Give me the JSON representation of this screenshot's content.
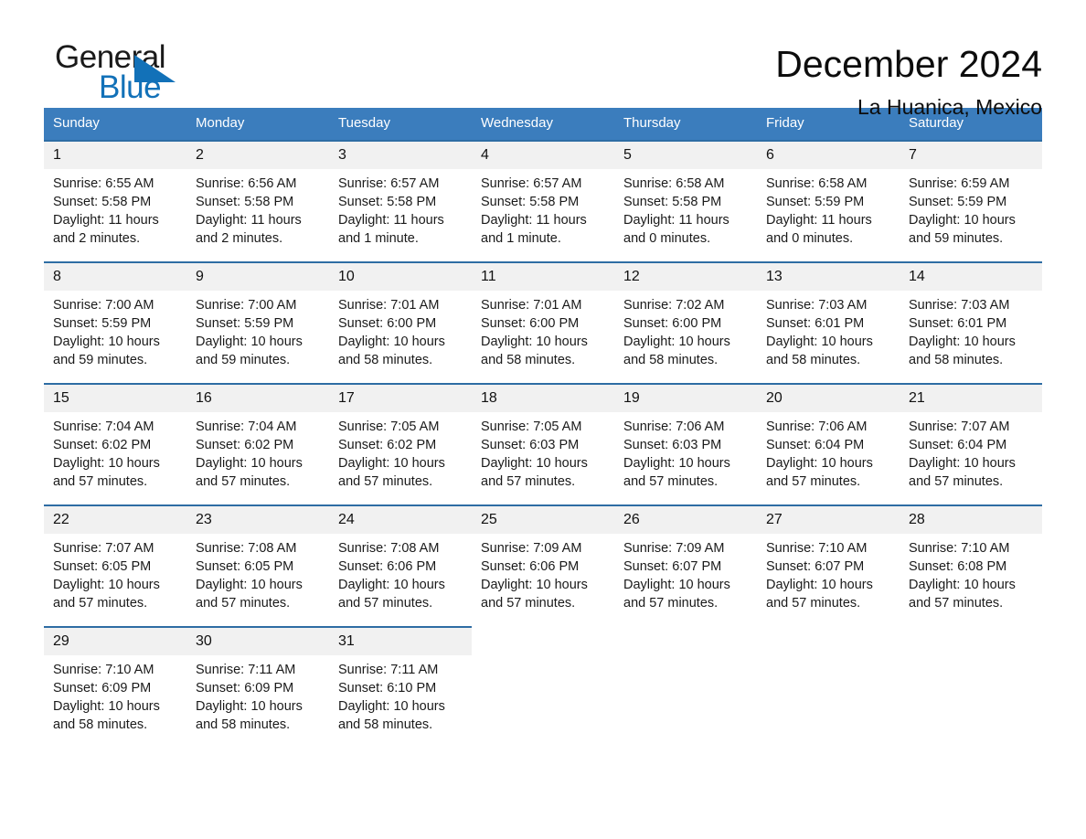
{
  "brand": {
    "name_part1": "General",
    "name_part2": "Blue",
    "accent_color": "#1271b8",
    "triangle_icon": "triangle-icon"
  },
  "header": {
    "title": "December 2024",
    "subtitle": "La Huanica, Mexico"
  },
  "calendar": {
    "header_bg": "#3b7dbd",
    "row_rule_color": "#2e6da4",
    "daynum_bg": "#f1f1f1",
    "weekday_headers": [
      "Sunday",
      "Monday",
      "Tuesday",
      "Wednesday",
      "Thursday",
      "Friday",
      "Saturday"
    ],
    "weeks": [
      [
        {
          "day": "1",
          "sunrise": "Sunrise: 6:55 AM",
          "sunset": "Sunset: 5:58 PM",
          "daylight_line1": "Daylight: 11 hours",
          "daylight_line2": "and 2 minutes."
        },
        {
          "day": "2",
          "sunrise": "Sunrise: 6:56 AM",
          "sunset": "Sunset: 5:58 PM",
          "daylight_line1": "Daylight: 11 hours",
          "daylight_line2": "and 2 minutes."
        },
        {
          "day": "3",
          "sunrise": "Sunrise: 6:57 AM",
          "sunset": "Sunset: 5:58 PM",
          "daylight_line1": "Daylight: 11 hours",
          "daylight_line2": "and 1 minute."
        },
        {
          "day": "4",
          "sunrise": "Sunrise: 6:57 AM",
          "sunset": "Sunset: 5:58 PM",
          "daylight_line1": "Daylight: 11 hours",
          "daylight_line2": "and 1 minute."
        },
        {
          "day": "5",
          "sunrise": "Sunrise: 6:58 AM",
          "sunset": "Sunset: 5:58 PM",
          "daylight_line1": "Daylight: 11 hours",
          "daylight_line2": "and 0 minutes."
        },
        {
          "day": "6",
          "sunrise": "Sunrise: 6:58 AM",
          "sunset": "Sunset: 5:59 PM",
          "daylight_line1": "Daylight: 11 hours",
          "daylight_line2": "and 0 minutes."
        },
        {
          "day": "7",
          "sunrise": "Sunrise: 6:59 AM",
          "sunset": "Sunset: 5:59 PM",
          "daylight_line1": "Daylight: 10 hours",
          "daylight_line2": "and 59 minutes."
        }
      ],
      [
        {
          "day": "8",
          "sunrise": "Sunrise: 7:00 AM",
          "sunset": "Sunset: 5:59 PM",
          "daylight_line1": "Daylight: 10 hours",
          "daylight_line2": "and 59 minutes."
        },
        {
          "day": "9",
          "sunrise": "Sunrise: 7:00 AM",
          "sunset": "Sunset: 5:59 PM",
          "daylight_line1": "Daylight: 10 hours",
          "daylight_line2": "and 59 minutes."
        },
        {
          "day": "10",
          "sunrise": "Sunrise: 7:01 AM",
          "sunset": "Sunset: 6:00 PM",
          "daylight_line1": "Daylight: 10 hours",
          "daylight_line2": "and 58 minutes."
        },
        {
          "day": "11",
          "sunrise": "Sunrise: 7:01 AM",
          "sunset": "Sunset: 6:00 PM",
          "daylight_line1": "Daylight: 10 hours",
          "daylight_line2": "and 58 minutes."
        },
        {
          "day": "12",
          "sunrise": "Sunrise: 7:02 AM",
          "sunset": "Sunset: 6:00 PM",
          "daylight_line1": "Daylight: 10 hours",
          "daylight_line2": "and 58 minutes."
        },
        {
          "day": "13",
          "sunrise": "Sunrise: 7:03 AM",
          "sunset": "Sunset: 6:01 PM",
          "daylight_line1": "Daylight: 10 hours",
          "daylight_line2": "and 58 minutes."
        },
        {
          "day": "14",
          "sunrise": "Sunrise: 7:03 AM",
          "sunset": "Sunset: 6:01 PM",
          "daylight_line1": "Daylight: 10 hours",
          "daylight_line2": "and 58 minutes."
        }
      ],
      [
        {
          "day": "15",
          "sunrise": "Sunrise: 7:04 AM",
          "sunset": "Sunset: 6:02 PM",
          "daylight_line1": "Daylight: 10 hours",
          "daylight_line2": "and 57 minutes."
        },
        {
          "day": "16",
          "sunrise": "Sunrise: 7:04 AM",
          "sunset": "Sunset: 6:02 PM",
          "daylight_line1": "Daylight: 10 hours",
          "daylight_line2": "and 57 minutes."
        },
        {
          "day": "17",
          "sunrise": "Sunrise: 7:05 AM",
          "sunset": "Sunset: 6:02 PM",
          "daylight_line1": "Daylight: 10 hours",
          "daylight_line2": "and 57 minutes."
        },
        {
          "day": "18",
          "sunrise": "Sunrise: 7:05 AM",
          "sunset": "Sunset: 6:03 PM",
          "daylight_line1": "Daylight: 10 hours",
          "daylight_line2": "and 57 minutes."
        },
        {
          "day": "19",
          "sunrise": "Sunrise: 7:06 AM",
          "sunset": "Sunset: 6:03 PM",
          "daylight_line1": "Daylight: 10 hours",
          "daylight_line2": "and 57 minutes."
        },
        {
          "day": "20",
          "sunrise": "Sunrise: 7:06 AM",
          "sunset": "Sunset: 6:04 PM",
          "daylight_line1": "Daylight: 10 hours",
          "daylight_line2": "and 57 minutes."
        },
        {
          "day": "21",
          "sunrise": "Sunrise: 7:07 AM",
          "sunset": "Sunset: 6:04 PM",
          "daylight_line1": "Daylight: 10 hours",
          "daylight_line2": "and 57 minutes."
        }
      ],
      [
        {
          "day": "22",
          "sunrise": "Sunrise: 7:07 AM",
          "sunset": "Sunset: 6:05 PM",
          "daylight_line1": "Daylight: 10 hours",
          "daylight_line2": "and 57 minutes."
        },
        {
          "day": "23",
          "sunrise": "Sunrise: 7:08 AM",
          "sunset": "Sunset: 6:05 PM",
          "daylight_line1": "Daylight: 10 hours",
          "daylight_line2": "and 57 minutes."
        },
        {
          "day": "24",
          "sunrise": "Sunrise: 7:08 AM",
          "sunset": "Sunset: 6:06 PM",
          "daylight_line1": "Daylight: 10 hours",
          "daylight_line2": "and 57 minutes."
        },
        {
          "day": "25",
          "sunrise": "Sunrise: 7:09 AM",
          "sunset": "Sunset: 6:06 PM",
          "daylight_line1": "Daylight: 10 hours",
          "daylight_line2": "and 57 minutes."
        },
        {
          "day": "26",
          "sunrise": "Sunrise: 7:09 AM",
          "sunset": "Sunset: 6:07 PM",
          "daylight_line1": "Daylight: 10 hours",
          "daylight_line2": "and 57 minutes."
        },
        {
          "day": "27",
          "sunrise": "Sunrise: 7:10 AM",
          "sunset": "Sunset: 6:07 PM",
          "daylight_line1": "Daylight: 10 hours",
          "daylight_line2": "and 57 minutes."
        },
        {
          "day": "28",
          "sunrise": "Sunrise: 7:10 AM",
          "sunset": "Sunset: 6:08 PM",
          "daylight_line1": "Daylight: 10 hours",
          "daylight_line2": "and 57 minutes."
        }
      ],
      [
        {
          "day": "29",
          "sunrise": "Sunrise: 7:10 AM",
          "sunset": "Sunset: 6:09 PM",
          "daylight_line1": "Daylight: 10 hours",
          "daylight_line2": "and 58 minutes."
        },
        {
          "day": "30",
          "sunrise": "Sunrise: 7:11 AM",
          "sunset": "Sunset: 6:09 PM",
          "daylight_line1": "Daylight: 10 hours",
          "daylight_line2": "and 58 minutes."
        },
        {
          "day": "31",
          "sunrise": "Sunrise: 7:11 AM",
          "sunset": "Sunset: 6:10 PM",
          "daylight_line1": "Daylight: 10 hours",
          "daylight_line2": "and 58 minutes."
        },
        null,
        null,
        null,
        null
      ]
    ]
  }
}
